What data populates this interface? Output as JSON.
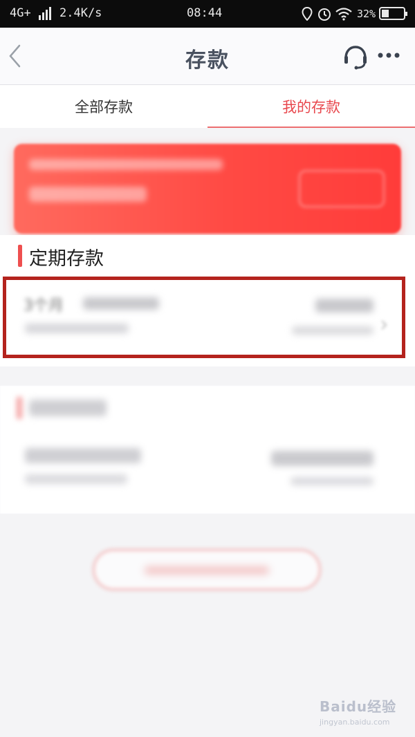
{
  "status_bar": {
    "network": "4G+",
    "speed": "2.4K/s",
    "time": "08:44",
    "battery_percent": "32%",
    "battery_level": 0.32,
    "icons": [
      "signal-icon",
      "location-icon",
      "alarm-icon",
      "wifi-icon",
      "battery-icon"
    ]
  },
  "nav": {
    "title": "存款",
    "icons": [
      "back-icon",
      "customer-service-icon",
      "more-icon"
    ]
  },
  "tabs": [
    {
      "label": "全部存款",
      "active": false
    },
    {
      "label": "我的存款",
      "active": true
    }
  ],
  "section_fixed": {
    "title": "定期存款",
    "item_title_visible": "3个月"
  },
  "watermark": {
    "main": "Baidu经验",
    "sub": "jingyan.baidu.com"
  },
  "colors": {
    "accent": "#e8474d",
    "highlight_box": "#b4231d",
    "banner": "#ff4a44"
  }
}
